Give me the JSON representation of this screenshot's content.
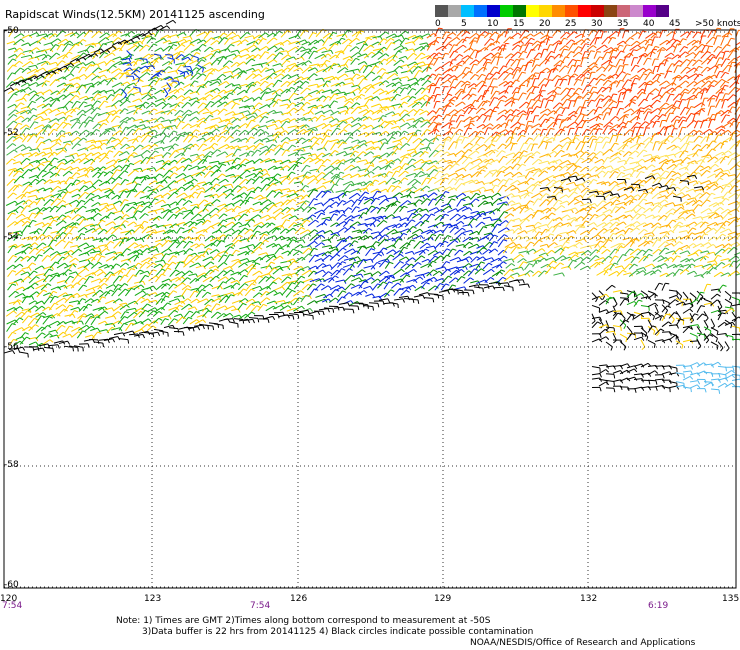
{
  "title": "Rapidscat Winds(12.5KM) 20141125 ascending",
  "colorbar": {
    "colors": [
      "#555555",
      "#a8a8a8",
      "#00bfff",
      "#0070ff",
      "#0000cc",
      "#00cc00",
      "#007700",
      "#ffff00",
      "#ffd700",
      "#ff8c00",
      "#ff5000",
      "#ff0000",
      "#cc0000",
      "#8b4513",
      "#cc6677",
      "#cc88cc",
      "#9900cc",
      "#550088"
    ],
    "labels": [
      "0",
      "5",
      "10",
      "15",
      "20",
      "25",
      "30",
      "35",
      "40",
      "45",
      ">50 knots"
    ]
  },
  "axes": {
    "lat_labels": [
      "-50",
      "-52",
      "-54",
      "-56",
      "-58",
      "-60"
    ],
    "lon_labels": [
      "120",
      "123",
      "126",
      "129",
      "132",
      "135"
    ]
  },
  "times": [
    "7:54",
    "7:54",
    "6:19"
  ],
  "notes": {
    "line1": "Note: 1) Times are GMT 2)Times along bottom correspond to measurement at -50S",
    "line2": "3)Data buffer is 22 hrs from 20141125 4) Black circles indicate possible contamination",
    "credit": "NOAA/NESDIS/Office of Research and Applications"
  }
}
